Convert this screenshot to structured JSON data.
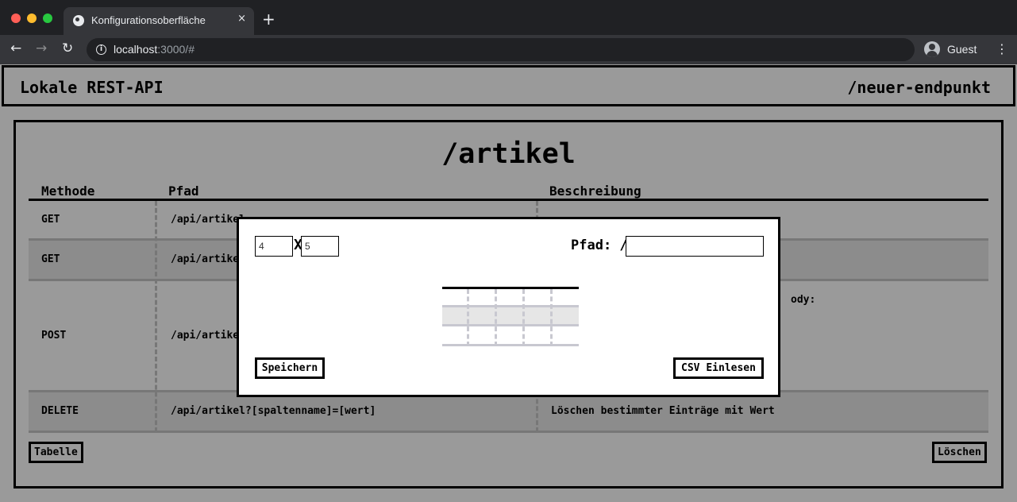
{
  "browser": {
    "tab_title": "Konfigurationsoberfläche",
    "tab_close": "×",
    "new_tab": "+",
    "url_host": "localhost",
    "url_rest": ":3000/#",
    "profile_label": "Guest",
    "icons": [
      "globe-icon",
      "close-icon",
      "plus-icon",
      "back-arrow-icon",
      "forward-arrow-icon",
      "reload-icon",
      "info-icon",
      "profile-icon",
      "kebab-menu-icon"
    ]
  },
  "header": {
    "title": "Lokale REST-API",
    "new_endpoint": "/neuer-endpunkt"
  },
  "panel": {
    "title": "/artikel",
    "columns": [
      "Methode",
      "Pfad",
      "Beschreibung"
    ],
    "rows": [
      {
        "method": "GET",
        "path": "/api/artikel",
        "description": ""
      },
      {
        "method": "GET",
        "path": "/api/artikel",
        "description": ""
      },
      {
        "method": "POST",
        "path": "/api/artikel",
        "description": "ody:"
      },
      {
        "method": "DELETE",
        "path": "/api/artikel?[spaltenname]=[wert]",
        "description": "Löschen bestimmter Einträge mit Wert"
      }
    ],
    "table_button": "Tabelle",
    "delete_button": "Löschen"
  },
  "modal": {
    "rows_value": "4",
    "cols_value": "5",
    "x_label": "X",
    "path_label": "Pfad: /",
    "path_value": "",
    "save_button": "Speichern",
    "csv_button": "CSV Einlesen"
  }
}
